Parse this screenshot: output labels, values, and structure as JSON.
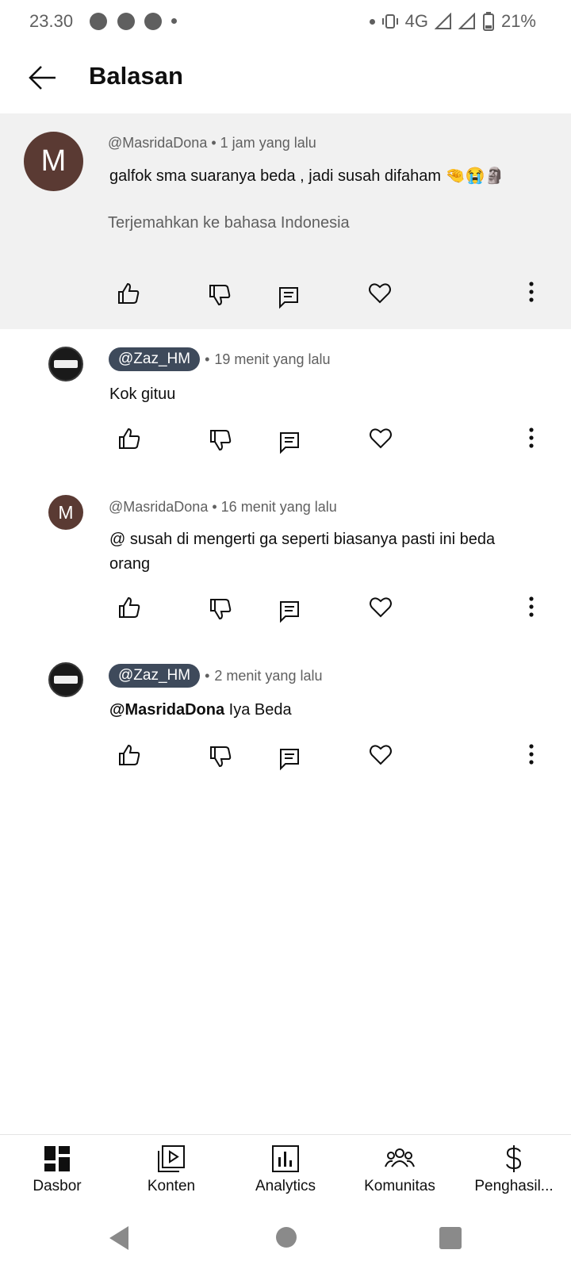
{
  "status_bar": {
    "time": "23.30",
    "network": "4G",
    "battery": "21%"
  },
  "header": {
    "title": "Balasan"
  },
  "parent_comment": {
    "avatar_letter": "M",
    "author": "@MasridaDona",
    "time": "1 jam yang lalu",
    "text": "galfok sma suaranya beda , jadi susah difaham 🤏😭🗿",
    "translate_label": "Terjemahkan ke bahasa Indonesia"
  },
  "replies": [
    {
      "author": "@Zaz_HM",
      "time": "19 menit yang lalu",
      "text": "Kok gituu"
    },
    {
      "avatar_letter": "M",
      "author": "@MasridaDona",
      "time": "16 menit yang lalu",
      "text_line1": "@ susah di mengerti ga seperti biasanya pasti ini beda",
      "text_line2": "orang"
    },
    {
      "author": "@Zaz_HM",
      "time": "2 menit yang lalu",
      "mention": "@MasridaDona",
      "text": "Iya Beda"
    }
  ],
  "meta_separator": "•",
  "bottom_nav": {
    "items": [
      {
        "label": "Dasbor",
        "icon": "dashboard-icon"
      },
      {
        "label": "Konten",
        "icon": "content-icon"
      },
      {
        "label": "Analytics",
        "icon": "analytics-icon"
      },
      {
        "label": "Komunitas",
        "icon": "community-icon"
      },
      {
        "label": "Penghasil...",
        "icon": "dollar-icon"
      }
    ]
  },
  "colors": {
    "accent_badge": "#3e4a5b",
    "avatar_brown": "#5a3a33",
    "highlight_bg": "#f1f1f1"
  }
}
